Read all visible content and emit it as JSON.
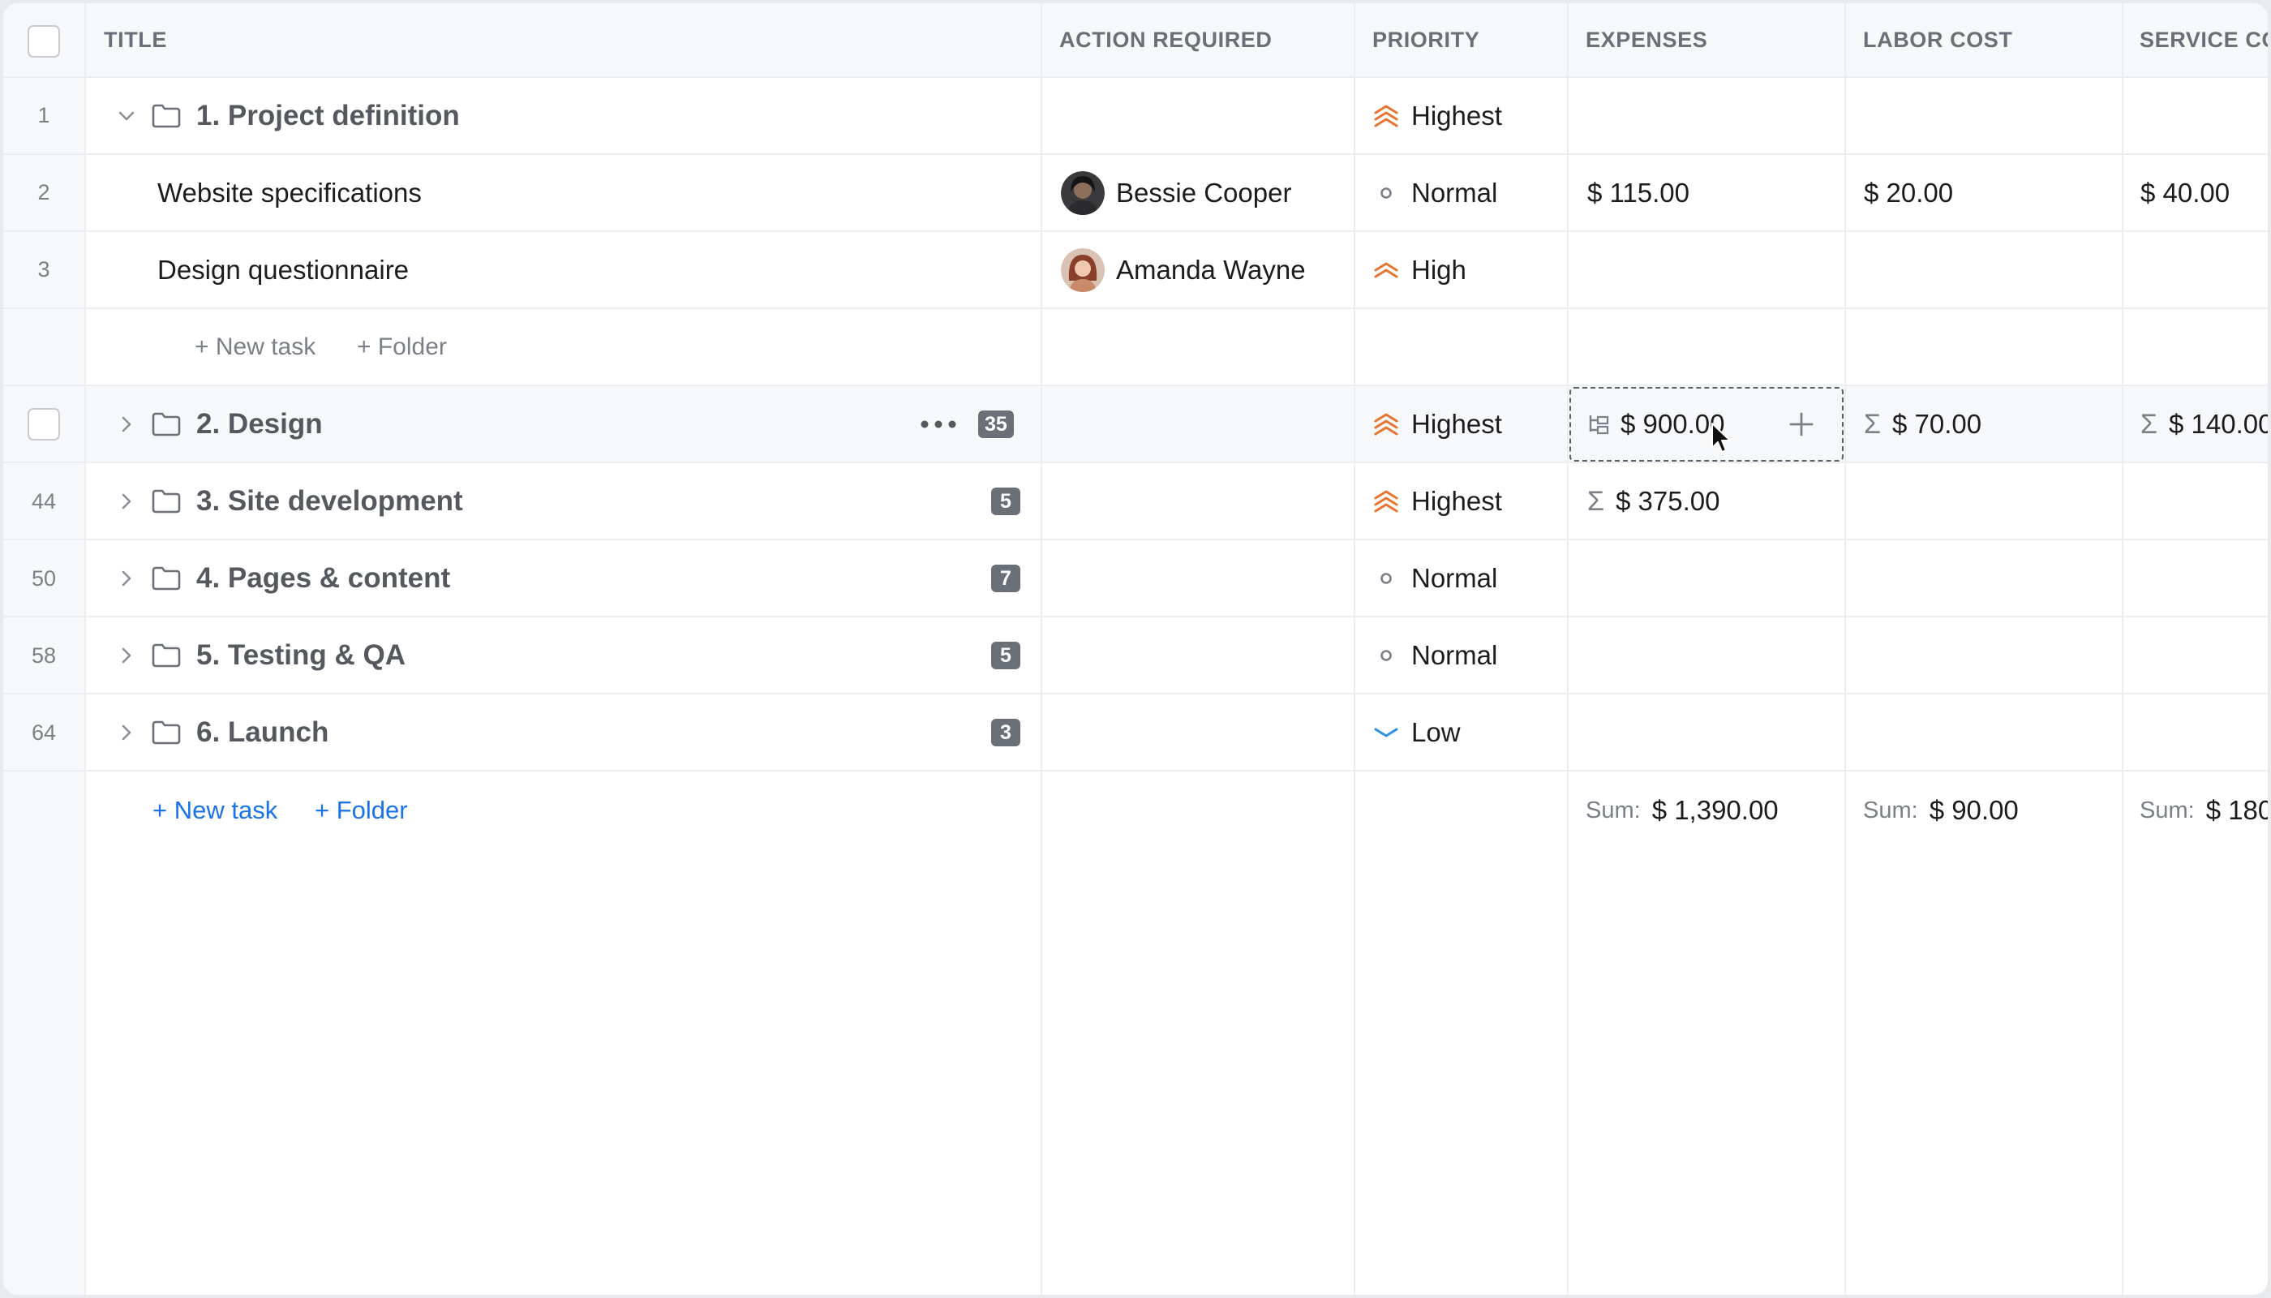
{
  "columns": {
    "title": "TITLE",
    "action": "ACTION REQUIRED",
    "priority": "PRIORITY",
    "expenses": "EXPENSES",
    "labor": "LABOR COST",
    "service": "SERVICE CO"
  },
  "rows": [
    {
      "num": "1",
      "title": "1. Project definition",
      "priority": "Highest"
    },
    {
      "num": "2",
      "title": "Website specifications",
      "assignee": "Bessie Cooper",
      "priority": "Normal",
      "expenses": "$ 115.00",
      "labor": "$ 20.00",
      "service": "$ 40.00"
    },
    {
      "num": "3",
      "title": "Design questionnaire",
      "assignee": "Amanda Wayne",
      "priority": "High"
    },
    {
      "new_task": "+ New task",
      "new_folder": "+ Folder"
    },
    {
      "title": "2. Design",
      "count": "35",
      "priority": "Highest",
      "expenses": "$ 900.00",
      "labor": "$ 70.00",
      "service": "$ 140.00"
    },
    {
      "num": "44",
      "title": "3. Site development",
      "count": "5",
      "priority": "Highest",
      "expenses": "$ 375.00"
    },
    {
      "num": "50",
      "title": "4. Pages & content",
      "count": "7",
      "priority": "Normal"
    },
    {
      "num": "58",
      "title": "5. Testing & QA",
      "count": "5",
      "priority": "Normal"
    },
    {
      "num": "64",
      "title": "6. Launch",
      "count": "3",
      "priority": "Low"
    }
  ],
  "footer": {
    "new_task": "+ New task",
    "new_folder": "+ Folder",
    "sum_label": "Sum:",
    "expenses_sum": "$ 1,390.00",
    "labor_sum": "$ 90.00",
    "service_sum": "$ 180"
  },
  "colors": {
    "priority_high": "#e8732e",
    "priority_low": "#2f8fe6",
    "link": "#1a73e8"
  }
}
